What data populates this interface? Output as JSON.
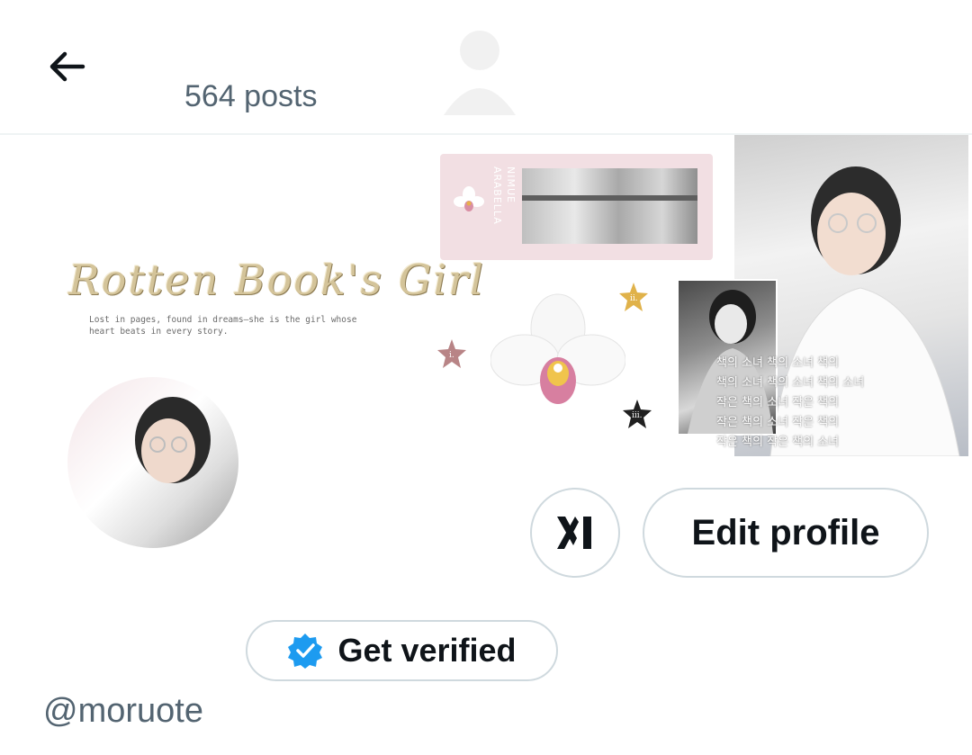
{
  "header": {
    "posts_count": "564 posts"
  },
  "banner": {
    "title": "Rotten Book's Girl",
    "tagline": "Lost in pages, found in dreams—she is the girl whose heart beats in every story.",
    "bookmark_names": [
      "NIMUE",
      "ARABELLA"
    ],
    "star_labels": [
      "i.",
      "ii.",
      "iii."
    ],
    "korean_lines": [
      "책의 소녀 책의 소녀 책의",
      "책의 소녀 책의 소녀 책의 소녀",
      "작은 책의 소녀 작은 책의",
      "작은 책의 소녀 작은 책의",
      "작은 책의 작은 책의 소녀"
    ],
    "colors": {
      "gold": "#d4c49a",
      "pink": "#f2dfe3",
      "star_gold": "#e0b24a",
      "star_rose": "#b88486",
      "star_dark": "#202020"
    }
  },
  "actions": {
    "grok_icon": "grok-icon",
    "edit_label": "Edit profile",
    "verify_label": "Get verified",
    "verify_badge_color": "#1d9bf0"
  },
  "profile": {
    "handle": "@moruote"
  }
}
